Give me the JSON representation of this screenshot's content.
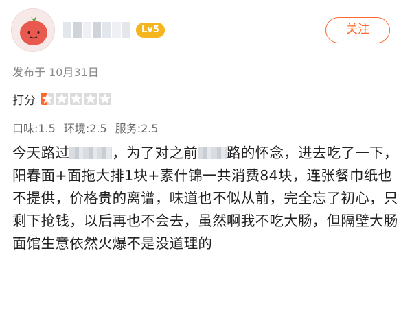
{
  "header": {
    "level_badge": "Lv5",
    "follow_label": "关注"
  },
  "post": {
    "date": "发布于 10月31日"
  },
  "rating": {
    "label": "打分",
    "score_fraction": 0.1,
    "stars_total": 5
  },
  "sub_scores": [
    {
      "label": "口味:1.5"
    },
    {
      "label": "环境:2.5"
    },
    {
      "label": "服务:2.5"
    }
  ],
  "review": {
    "part1": "今天路过",
    "part2": "，为了对之前",
    "part3": "路的怀念，进去吃了一下，阳春面+面拖大排1块+素什锦一共消费84块，连张餐巾纸也不提供，价格贵的离谱，味道也不似从前，完全忘了初心，只剩下抢钱，以后再也不会去，虽然啊我不吃大肠，但隔壁大肠面馆生意依然火爆不是没道理的"
  },
  "colors": {
    "accent": "#ff6a2c",
    "star_fill": "#ff6a2c",
    "star_empty": "#dcdcdc",
    "badge": "#f5b51f"
  }
}
